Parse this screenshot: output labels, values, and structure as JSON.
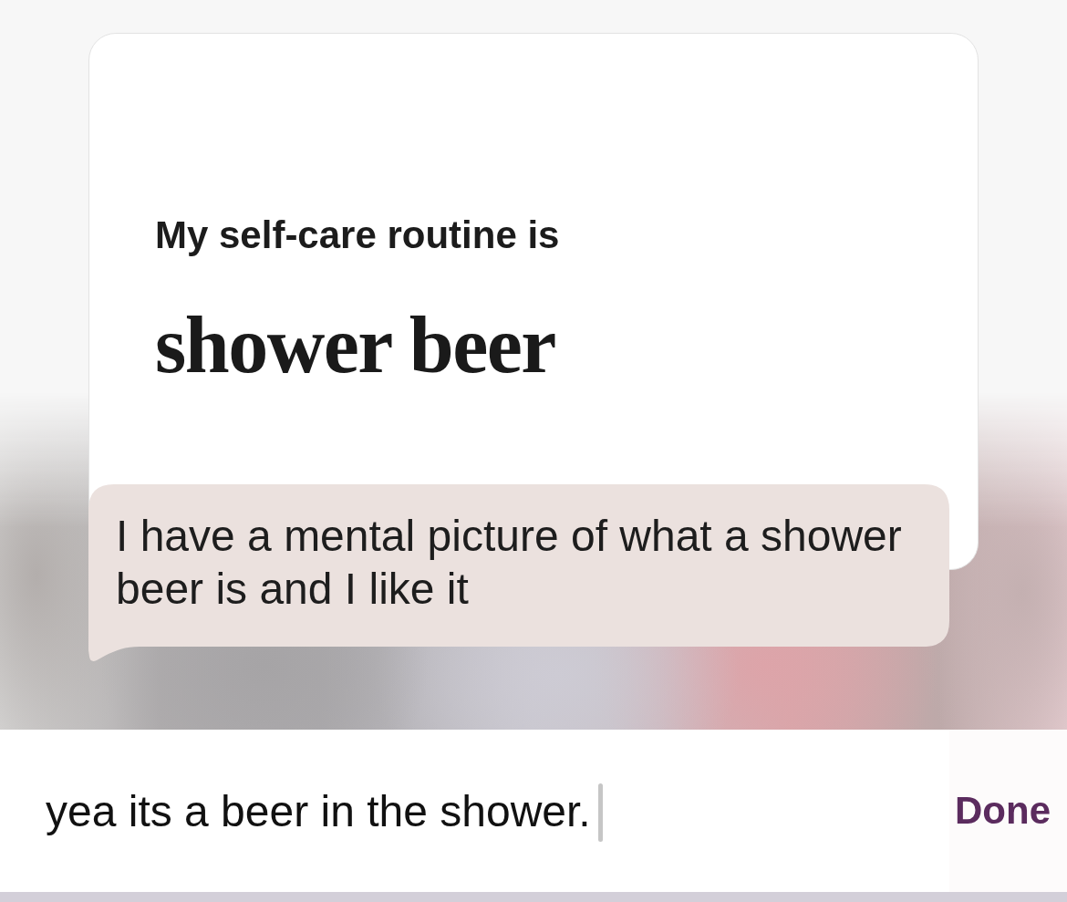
{
  "card": {
    "prompt": "My self-care routine is",
    "answer": "shower beer"
  },
  "message": {
    "text": "I have a mental picture of what a shower beer is and I like it"
  },
  "composer": {
    "value": "yea its a beer in the shower.",
    "focused": true,
    "action": "Done"
  }
}
